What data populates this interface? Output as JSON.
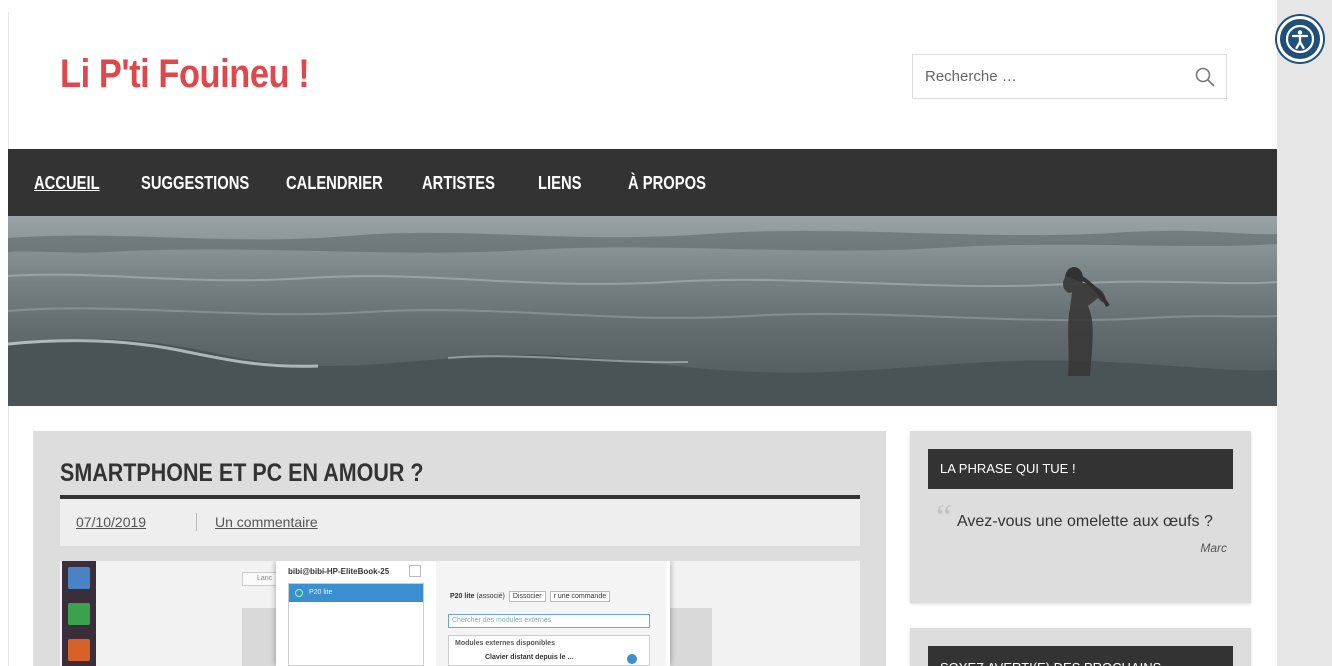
{
  "site": {
    "title": "Li P'ti Fouineu !"
  },
  "search": {
    "placeholder": "Recherche …"
  },
  "nav": {
    "items": [
      {
        "label": "Accueil"
      },
      {
        "label": "Suggestions"
      },
      {
        "label": "Calendrier"
      },
      {
        "label": "Artistes"
      },
      {
        "label": "Liens"
      },
      {
        "label": "À propos"
      }
    ],
    "active_index": 0
  },
  "post": {
    "title": "Smartphone et PC en amour ?",
    "date": "07/10/2019",
    "comments": "Un commentaire",
    "screenshot": {
      "launcher_label": "Lanc",
      "window_title": "bibi@bibi-HP-EliteBook-25",
      "device_name": "P20 lite",
      "device_status_name": "P20 lite",
      "device_status": "(associé)",
      "dissociate_label": "Dissocier",
      "command_label": "r une commande",
      "search_placeholder": "Chercher des modules externes",
      "modules_heading": "Modules externes disponibles",
      "module_item": "Clavier distant depuis le ..."
    }
  },
  "sidebar": {
    "widget1": {
      "heading": "La phrase qui tue !",
      "quote": "Avez-vous une omelette aux œufs ?",
      "author": "Marc"
    },
    "widget2": {
      "heading": "Soyez averti(e) des prochains"
    }
  },
  "colors": {
    "title_red": "#e0474c",
    "nav_bg": "#333333",
    "accessibility_blue": "#1f4f7a"
  },
  "icons": {
    "search": "search-icon",
    "accessibility": "accessibility-icon",
    "quote": "quote-icon"
  }
}
